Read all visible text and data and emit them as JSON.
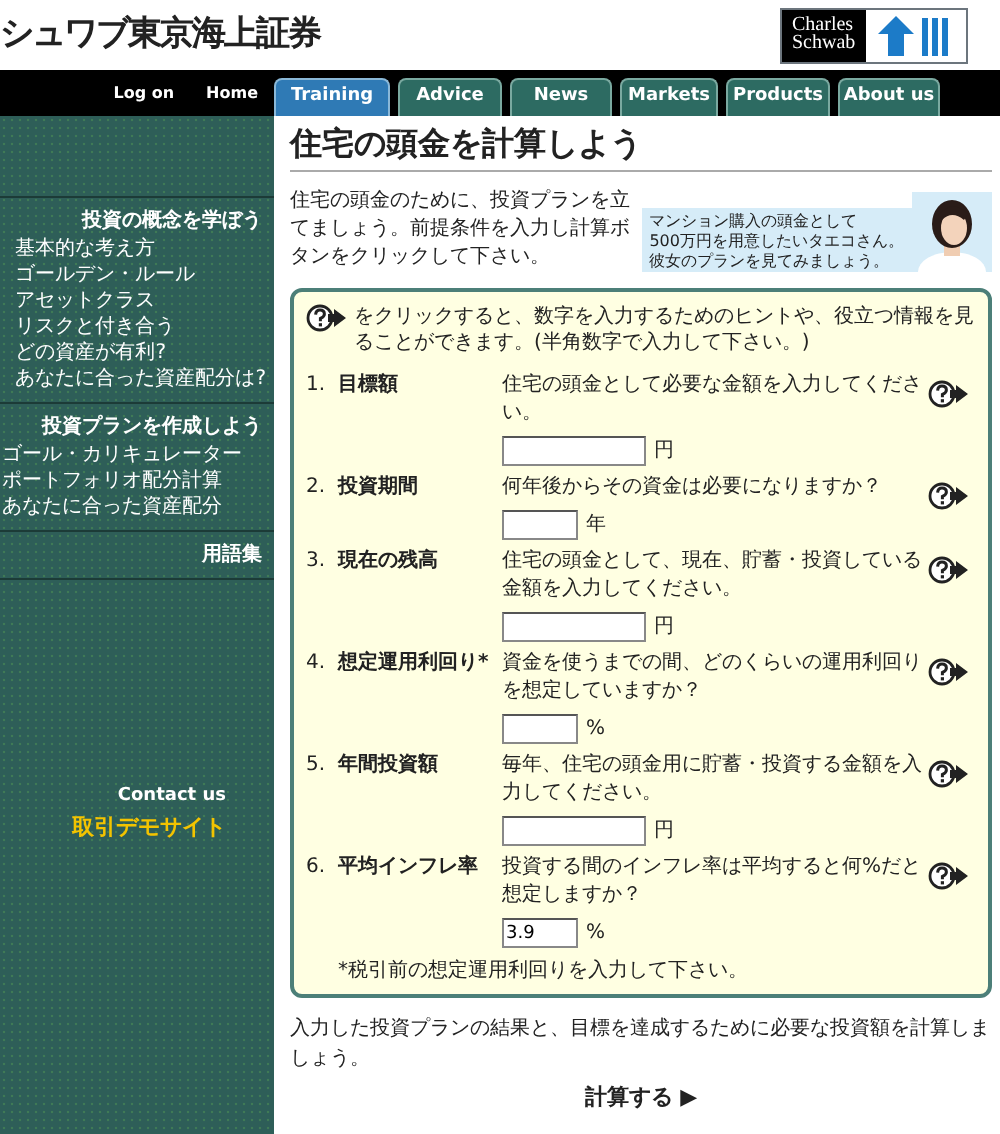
{
  "header": {
    "site_name": "シュワブ東京海上証券",
    "logo_text": "Charles Schwab"
  },
  "top_links": [
    {
      "label": "Log on"
    },
    {
      "label": "Home"
    }
  ],
  "tabs": [
    {
      "label": "Training",
      "selected": true
    },
    {
      "label": "Advice",
      "selected": false
    },
    {
      "label": "News",
      "selected": false
    },
    {
      "label": "Markets",
      "selected": false
    },
    {
      "label": "Products",
      "selected": false
    },
    {
      "label": "About us",
      "selected": false
    }
  ],
  "sidebar": {
    "sections": [
      {
        "title": "投資の概念を学ぼう",
        "items": [
          "基本的な考え方",
          "ゴールデン・ルール",
          "アセットクラス",
          "リスクと付き合う",
          "どの資産が有利?",
          "あなたに合った資産配分は?"
        ]
      },
      {
        "title": "投資プランを作成しよう",
        "items": [
          "ゴール・カリキュレーター",
          "ポートフォリオ配分計算",
          "あなたに合った資産配分"
        ]
      },
      {
        "title": "用語集"
      }
    ],
    "contact": "Contact us",
    "demo": "取引デモサイト"
  },
  "page": {
    "title": "住宅の頭金を計算しよう",
    "intro": "住宅の頭金のために、投資プランを立てましょう。前提条件を入力し計算ボタンをクリックして下さい。",
    "promo": {
      "lines": [
        "マンション購入の頭金として",
        "500万円を用意したいタエコさん。",
        "彼女のプランを見てみましょう。"
      ]
    },
    "form": {
      "hint": "をクリックすると、数字を入力するためのヒントや、役立つ情報を見ることができます。(半角数字で入力して下さい。)",
      "rows": [
        {
          "number": "1.",
          "label": "目標額",
          "question": "住宅の頭金として必要な金額を入力してください。",
          "kind": "wide",
          "unit": "円"
        },
        {
          "number": "2.",
          "label": "投資期間",
          "question": "何年後からその資金は必要になりますか？",
          "kind": "short",
          "unit": "年"
        },
        {
          "number": "3.",
          "label": "現在の残高",
          "question": "住宅の頭金として、現在、貯蓄・投資している金額を入力してください。",
          "kind": "wide",
          "unit": "円"
        },
        {
          "number": "4.",
          "label": "想定運用利回り*",
          "question": "資金を使うまでの間、どのくらいの運用利回りを想定していますか？",
          "kind": "short",
          "unit": "%"
        },
        {
          "number": "5.",
          "label": "年間投資額",
          "question": "毎年、住宅の頭金用に貯蓄・投資する金額を入力してください。",
          "kind": "wide",
          "unit": "円"
        },
        {
          "number": "6.",
          "label": "平均インフレ率",
          "question": "投資する間のインフレ率は平均すると何%だと想定しますか？",
          "kind": "short",
          "unit": "%",
          "value": "3.9"
        }
      ],
      "note": "*税引前の想定運用利回りを入力して下さい。"
    },
    "footer_text": "入力した投資プランの結果と、目標を達成するために必要な投資額を計算しましょう。",
    "submit": "計算する ▶"
  }
}
